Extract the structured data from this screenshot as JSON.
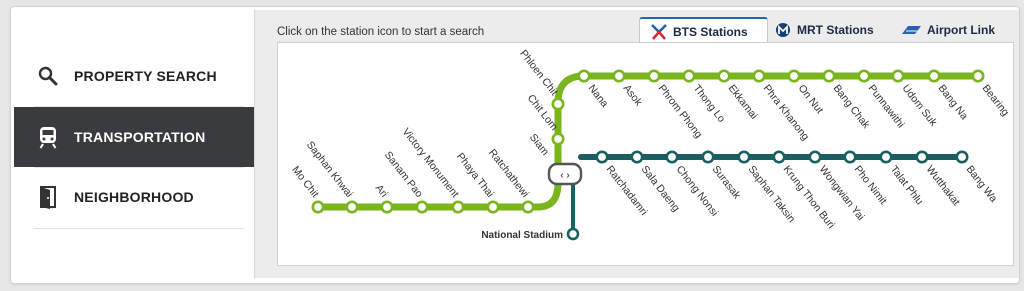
{
  "sidebar": {
    "items": [
      {
        "label": "PROPERTY SEARCH",
        "icon": "search-icon",
        "active": false
      },
      {
        "label": "TRANSPORTATION",
        "icon": "train-icon",
        "active": true
      },
      {
        "label": "NEIGHBORHOOD",
        "icon": "door-icon",
        "active": false
      }
    ]
  },
  "map": {
    "instruction": "Click on the station icon to start a search",
    "tabs": [
      {
        "label": "BTS Stations",
        "icon": "bts-logo-icon",
        "active": true
      },
      {
        "label": "MRT Stations",
        "icon": "mrt-logo-icon",
        "active": false
      },
      {
        "label": "Airport Link",
        "icon": "airport-link-icon",
        "active": false
      }
    ],
    "colors": {
      "sukhumvit_line": "#7ab51d",
      "silom_line": "#1b6060",
      "active_tab_accent": "#1b6ab0"
    },
    "sukhumvit_west": [
      "Mo Chit",
      "Saphan Khwai",
      "Ari",
      "Sanam Pao",
      "Victory Monument",
      "Phaya Thai",
      "Ratchathewi"
    ],
    "siam_station": "Siam",
    "sukhumvit_vertical": [
      "Chit Lom",
      "Phloen Chit"
    ],
    "sukhumvit_east": [
      "Nana",
      "Asok",
      "Phrom Phong",
      "Thong Lo",
      "Ekkamai",
      "Phra Khanong",
      "On Nut",
      "Bang Chak",
      "Punnawithi",
      "Udom Suk",
      "Bang Na",
      "Bearing"
    ],
    "silom_east": [
      "Ratchadamri",
      "Sala Daeng",
      "Chong Nonsi",
      "Surasak",
      "Saphan Taksin",
      "Krung Thon Buri",
      "Wongwian Yai",
      "Pho Nimit",
      "Talat Phlu",
      "Wutthakat",
      "Bang Wa"
    ],
    "national_stadium": "National Stadium"
  }
}
